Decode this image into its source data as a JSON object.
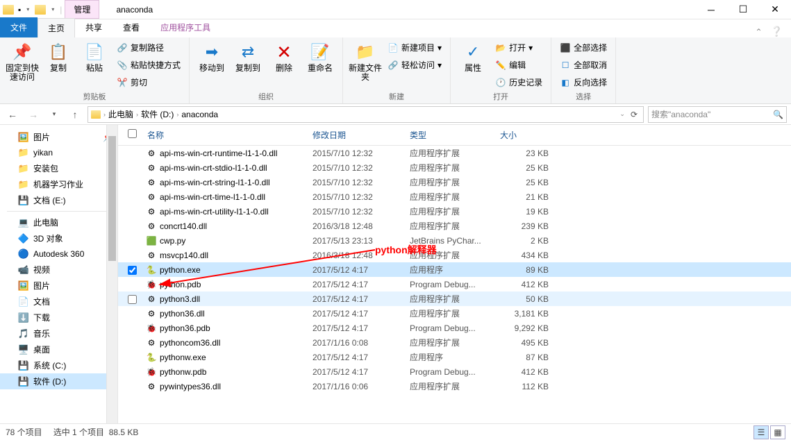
{
  "window": {
    "title": "anaconda",
    "tab_context": "管理"
  },
  "menu": {
    "file": "文件",
    "home": "主页",
    "share": "共享",
    "view": "查看",
    "app_tools": "应用程序工具"
  },
  "ribbon": {
    "pin": "固定到快速访问",
    "copy": "复制",
    "paste": "粘贴",
    "copy_path": "复制路径",
    "paste_shortcut": "粘贴快捷方式",
    "cut": "剪切",
    "clipboard_group": "剪贴板",
    "move_to": "移动到",
    "copy_to": "复制到",
    "delete": "删除",
    "rename": "重命名",
    "organize_group": "组织",
    "new_folder": "新建文件夹",
    "new_item": "新建项目",
    "easy_access": "轻松访问",
    "new_group": "新建",
    "properties": "属性",
    "open": "打开",
    "edit": "编辑",
    "history": "历史记录",
    "open_group": "打开",
    "select_all": "全部选择",
    "select_none": "全部取消",
    "invert": "反向选择",
    "select_group": "选择"
  },
  "address": {
    "crumbs": [
      "此电脑",
      "软件 (D:)",
      "anaconda"
    ],
    "search_placeholder": "搜索\"anaconda\""
  },
  "nav": {
    "items": [
      {
        "icon": "🖼️",
        "label": "图片",
        "pin": true
      },
      {
        "icon": "📁",
        "label": "yikan"
      },
      {
        "icon": "📁",
        "label": "安装包"
      },
      {
        "icon": "📁",
        "label": "机器学习作业"
      },
      {
        "icon": "💾",
        "label": "文档 (E:)"
      },
      {
        "icon": "💻",
        "label": "此电脑",
        "sep_before": true
      },
      {
        "icon": "🔷",
        "label": "3D 对象"
      },
      {
        "icon": "🔵",
        "label": "Autodesk 360"
      },
      {
        "icon": "📹",
        "label": "视频"
      },
      {
        "icon": "🖼️",
        "label": "图片"
      },
      {
        "icon": "📄",
        "label": "文档"
      },
      {
        "icon": "⬇️",
        "label": "下载"
      },
      {
        "icon": "🎵",
        "label": "音乐"
      },
      {
        "icon": "🖥️",
        "label": "桌面"
      },
      {
        "icon": "💾",
        "label": "系统 (C:)"
      },
      {
        "icon": "💾",
        "label": "软件 (D:)",
        "selected": true
      }
    ]
  },
  "columns": {
    "name": "名称",
    "date": "修改日期",
    "type": "类型",
    "size": "大小"
  },
  "files": [
    {
      "name": "api-ms-win-crt-runtime-l1-1-0.dll",
      "date": "2015/7/10 12:32",
      "type": "应用程序扩展",
      "size": "23 KB",
      "ic": "⚙"
    },
    {
      "name": "api-ms-win-crt-stdio-l1-1-0.dll",
      "date": "2015/7/10 12:32",
      "type": "应用程序扩展",
      "size": "25 KB",
      "ic": "⚙"
    },
    {
      "name": "api-ms-win-crt-string-l1-1-0.dll",
      "date": "2015/7/10 12:32",
      "type": "应用程序扩展",
      "size": "25 KB",
      "ic": "⚙"
    },
    {
      "name": "api-ms-win-crt-time-l1-1-0.dll",
      "date": "2015/7/10 12:32",
      "type": "应用程序扩展",
      "size": "21 KB",
      "ic": "⚙"
    },
    {
      "name": "api-ms-win-crt-utility-l1-1-0.dll",
      "date": "2015/7/10 12:32",
      "type": "应用程序扩展",
      "size": "19 KB",
      "ic": "⚙"
    },
    {
      "name": "concrt140.dll",
      "date": "2016/3/18 12:48",
      "type": "应用程序扩展",
      "size": "239 KB",
      "ic": "⚙"
    },
    {
      "name": "cwp.py",
      "date": "2017/5/13 23:13",
      "type": "JetBrains PyChar...",
      "size": "2 KB",
      "ic": "🟩"
    },
    {
      "name": "msvcp140.dll",
      "date": "2016/3/18 12:48",
      "type": "应用程序扩展",
      "size": "434 KB",
      "ic": "⚙"
    },
    {
      "name": "python.exe",
      "date": "2017/5/12 4:17",
      "type": "应用程序",
      "size": "89 KB",
      "ic": "🐍",
      "selected": true,
      "checked": true
    },
    {
      "name": "python.pdb",
      "date": "2017/5/12 4:17",
      "type": "Program Debug...",
      "size": "412 KB",
      "ic": "🐞"
    },
    {
      "name": "python3.dll",
      "date": "2017/5/12 4:17",
      "type": "应用程序扩展",
      "size": "50 KB",
      "ic": "⚙",
      "hover": true,
      "showcb": true
    },
    {
      "name": "python36.dll",
      "date": "2017/5/12 4:17",
      "type": "应用程序扩展",
      "size": "3,181 KB",
      "ic": "⚙"
    },
    {
      "name": "python36.pdb",
      "date": "2017/5/12 4:17",
      "type": "Program Debug...",
      "size": "9,292 KB",
      "ic": "🐞"
    },
    {
      "name": "pythoncom36.dll",
      "date": "2017/1/16 0:08",
      "type": "应用程序扩展",
      "size": "495 KB",
      "ic": "⚙"
    },
    {
      "name": "pythonw.exe",
      "date": "2017/5/12 4:17",
      "type": "应用程序",
      "size": "87 KB",
      "ic": "🐍"
    },
    {
      "name": "pythonw.pdb",
      "date": "2017/5/12 4:17",
      "type": "Program Debug...",
      "size": "412 KB",
      "ic": "🐞"
    },
    {
      "name": "pywintypes36.dll",
      "date": "2017/1/16 0:06",
      "type": "应用程序扩展",
      "size": "112 KB",
      "ic": "⚙"
    }
  ],
  "status": {
    "count": "78 个项目",
    "selection": "选中 1 个项目",
    "size": "88.5 KB"
  },
  "annotation": "python解释器"
}
